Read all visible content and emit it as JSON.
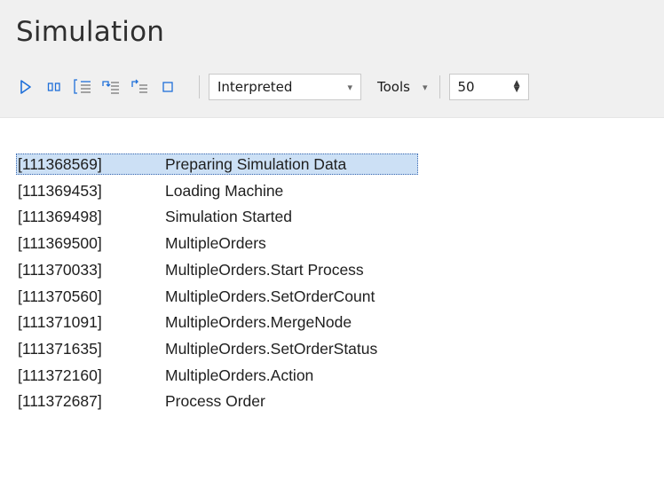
{
  "panel": {
    "title": "Simulation"
  },
  "toolbar": {
    "buttons": [
      {
        "icon": "play-icon",
        "name": "run-button"
      },
      {
        "icon": "pause-icon",
        "name": "pause-button"
      },
      {
        "icon": "step-into-icon",
        "name": "step-into-button"
      },
      {
        "icon": "step-over-icon",
        "name": "step-over-button"
      },
      {
        "icon": "step-out-icon",
        "name": "step-out-button"
      },
      {
        "icon": "stop-icon",
        "name": "stop-button"
      }
    ],
    "mode_dropdown": {
      "value": "Interpreted",
      "arrow": "▾"
    },
    "tools_menu": {
      "label": "Tools",
      "arrow": "▾"
    },
    "speed_spinner": {
      "value": "50",
      "up": "▲",
      "down": "▼"
    },
    "accent_color": "#1e6fd9"
  },
  "log": {
    "selected_index": 0,
    "selection_color": "#cce0f5",
    "rows": [
      {
        "timestamp": "[111368569]",
        "message": "Preparing Simulation Data"
      },
      {
        "timestamp": "[111369453]",
        "message": "Loading Machine"
      },
      {
        "timestamp": "[111369498]",
        "message": "Simulation Started"
      },
      {
        "timestamp": "[111369500]",
        "message": "MultipleOrders"
      },
      {
        "timestamp": "[111370033]",
        "message": "MultipleOrders.Start Process"
      },
      {
        "timestamp": "[111370560]",
        "message": "MultipleOrders.SetOrderCount"
      },
      {
        "timestamp": "[111371091]",
        "message": "MultipleOrders.MergeNode"
      },
      {
        "timestamp": "[111371635]",
        "message": "MultipleOrders.SetOrderStatus"
      },
      {
        "timestamp": "[111372160]",
        "message": "MultipleOrders.Action"
      },
      {
        "timestamp": "[111372687]",
        "message": "Process Order"
      }
    ]
  }
}
